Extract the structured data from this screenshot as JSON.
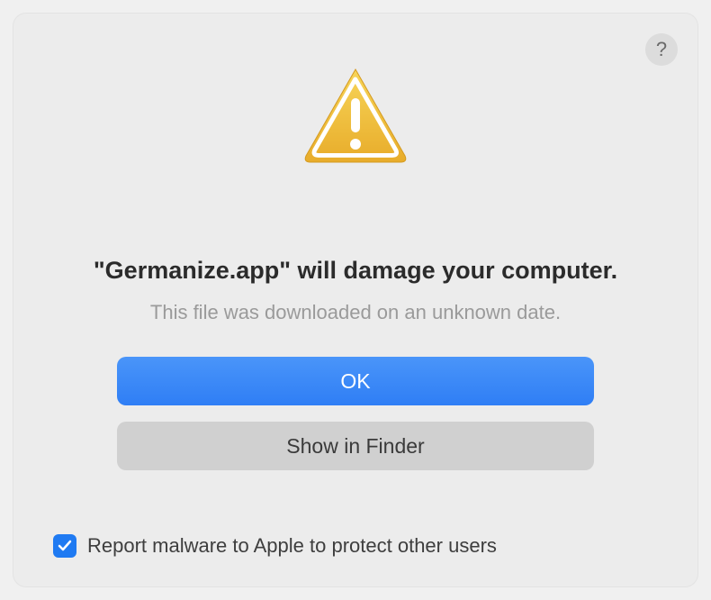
{
  "dialog": {
    "app_name": "Germanize.app",
    "title_prefix": "\"",
    "title_suffix": "\" will damage your computer.",
    "subtitle": "This file was downloaded on an unknown date.",
    "primary_button": "OK",
    "secondary_button": "Show in Finder",
    "checkbox_label": "Report malware to Apple to protect other users",
    "checkbox_checked": true,
    "help_label": "?"
  }
}
